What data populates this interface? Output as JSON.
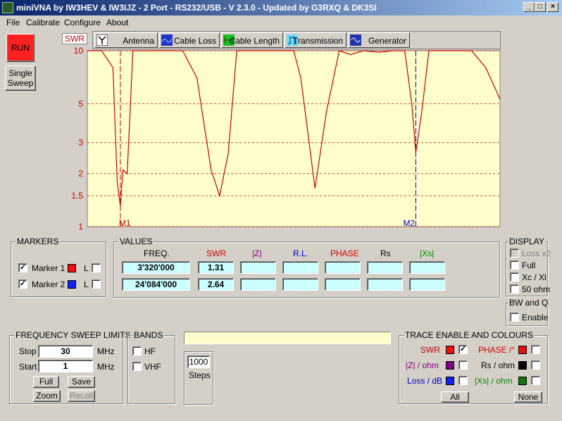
{
  "window": {
    "title": "miniVNA by IW3HEV & IW3IJZ - 2 Port - RS232/USB - V 2.3.0 - Updated by G3RXQ & DK3SI",
    "min": "_",
    "max": "□",
    "close": "×"
  },
  "menu": {
    "file": "File",
    "calibrate": "Calibrate",
    "configure": "Configure",
    "about": "About"
  },
  "controls": {
    "run": "RUN",
    "single_sweep_1": "Single",
    "single_sweep_2": "Sweep"
  },
  "tabs": {
    "swr_label": "SWR",
    "antenna": "Antenna",
    "cable_loss": "Cable Loss",
    "cable_length": "Cable Length",
    "transmission": "Transmission",
    "generator": "Generator"
  },
  "colors": {
    "trace": "#cc0000",
    "grid": "#cc0000",
    "plot_bg": "#ffffcc",
    "marker2": "#0000cc",
    "marker1": "#cc0000",
    "value_bg": "#ccffff"
  },
  "chart_data": {
    "type": "line",
    "ylabel": "SWR",
    "y_ticks": [
      "10",
      "5",
      "3",
      "2",
      "1.5",
      "1"
    ],
    "y_scale": "log",
    "ylim": [
      1,
      10
    ],
    "xlim": [
      1,
      30
    ],
    "x_unit": "MHz",
    "grid": true,
    "series": [
      {
        "name": "SWR",
        "x": [
          1.0,
          2.0,
          2.8,
          3.1,
          3.32,
          3.5,
          3.8,
          4.2,
          5.0,
          6.0,
          7.0,
          7.7,
          8.7,
          9.7,
          10.3,
          10.9,
          11.5,
          12.5,
          13.5,
          14.5,
          15.5,
          16.0,
          17.0,
          17.8,
          18.7,
          19.5,
          20.4,
          21.5,
          22.5,
          23.3,
          23.8,
          24.08,
          24.5,
          25.0,
          26.0,
          27.0,
          28.0,
          29.0,
          30.0
        ],
        "values": [
          10.0,
          10.0,
          8.0,
          1.8,
          1.31,
          2.1,
          2.0,
          10.0,
          10.0,
          10.0,
          10.0,
          10.0,
          7.0,
          2.1,
          1.5,
          2.6,
          10.0,
          10.0,
          10.0,
          10.0,
          10.0,
          7.0,
          1.65,
          4.5,
          10.0,
          9.5,
          10.0,
          9.8,
          10.0,
          10.0,
          5.0,
          2.64,
          4.5,
          10.0,
          10.0,
          10.0,
          10.0,
          8.0,
          5.3
        ]
      }
    ],
    "markers": [
      {
        "name": "M1",
        "x": 3.32
      },
      {
        "name": "M2",
        "x": 24.084
      }
    ]
  },
  "markers_panel": {
    "title": "MARKERS",
    "m1": "Marker 1",
    "m2": "Marker 2",
    "l": "L",
    "m1_checked": "✓",
    "m2_checked": "✓"
  },
  "values_panel": {
    "title": "VALUES",
    "headers": {
      "freq": "FREQ.",
      "swr": "SWR",
      "z": "|Z|",
      "rl": "R.L.",
      "phase": "PHASE",
      "rs": "Rs",
      "xs": "|Xs|"
    },
    "row1": {
      "freq": "3'320'000",
      "swr": "1.31"
    },
    "row2": {
      "freq": "24'084'000",
      "swr": "2.64"
    }
  },
  "display_panel": {
    "title": "DISPLAY",
    "loss": "Loss x2",
    "full": "Full",
    "xcxl": "Xc / Xl",
    "ohm50": "50 ohm"
  },
  "bwq_panel": {
    "title": "BW and Q",
    "enable": "Enable"
  },
  "freq_panel": {
    "title": "FREQUENCY SWEEP LIMITS",
    "stop_label": "Stop",
    "stop_value": "30",
    "start_label": "Start",
    "start_value": "1",
    "unit": "MHz",
    "full": "Full",
    "save": "Save",
    "zoom": "Zoom",
    "recall": "Recall"
  },
  "bands_panel": {
    "title": "BANDS",
    "hf": "HF",
    "vhf": "VHF"
  },
  "steps": {
    "value": "1000",
    "label": "Steps"
  },
  "trace_panel": {
    "title": "TRACE ENABLE AND COLOURS",
    "swr": "SWR",
    "swr_checked": "✓",
    "phase": "PHASE /°",
    "z": "|Z| / ohm",
    "rs": "Rs / ohm",
    "loss": "Loss / dB",
    "xs": "|Xs| / ohm",
    "all": "All",
    "none": "None"
  }
}
